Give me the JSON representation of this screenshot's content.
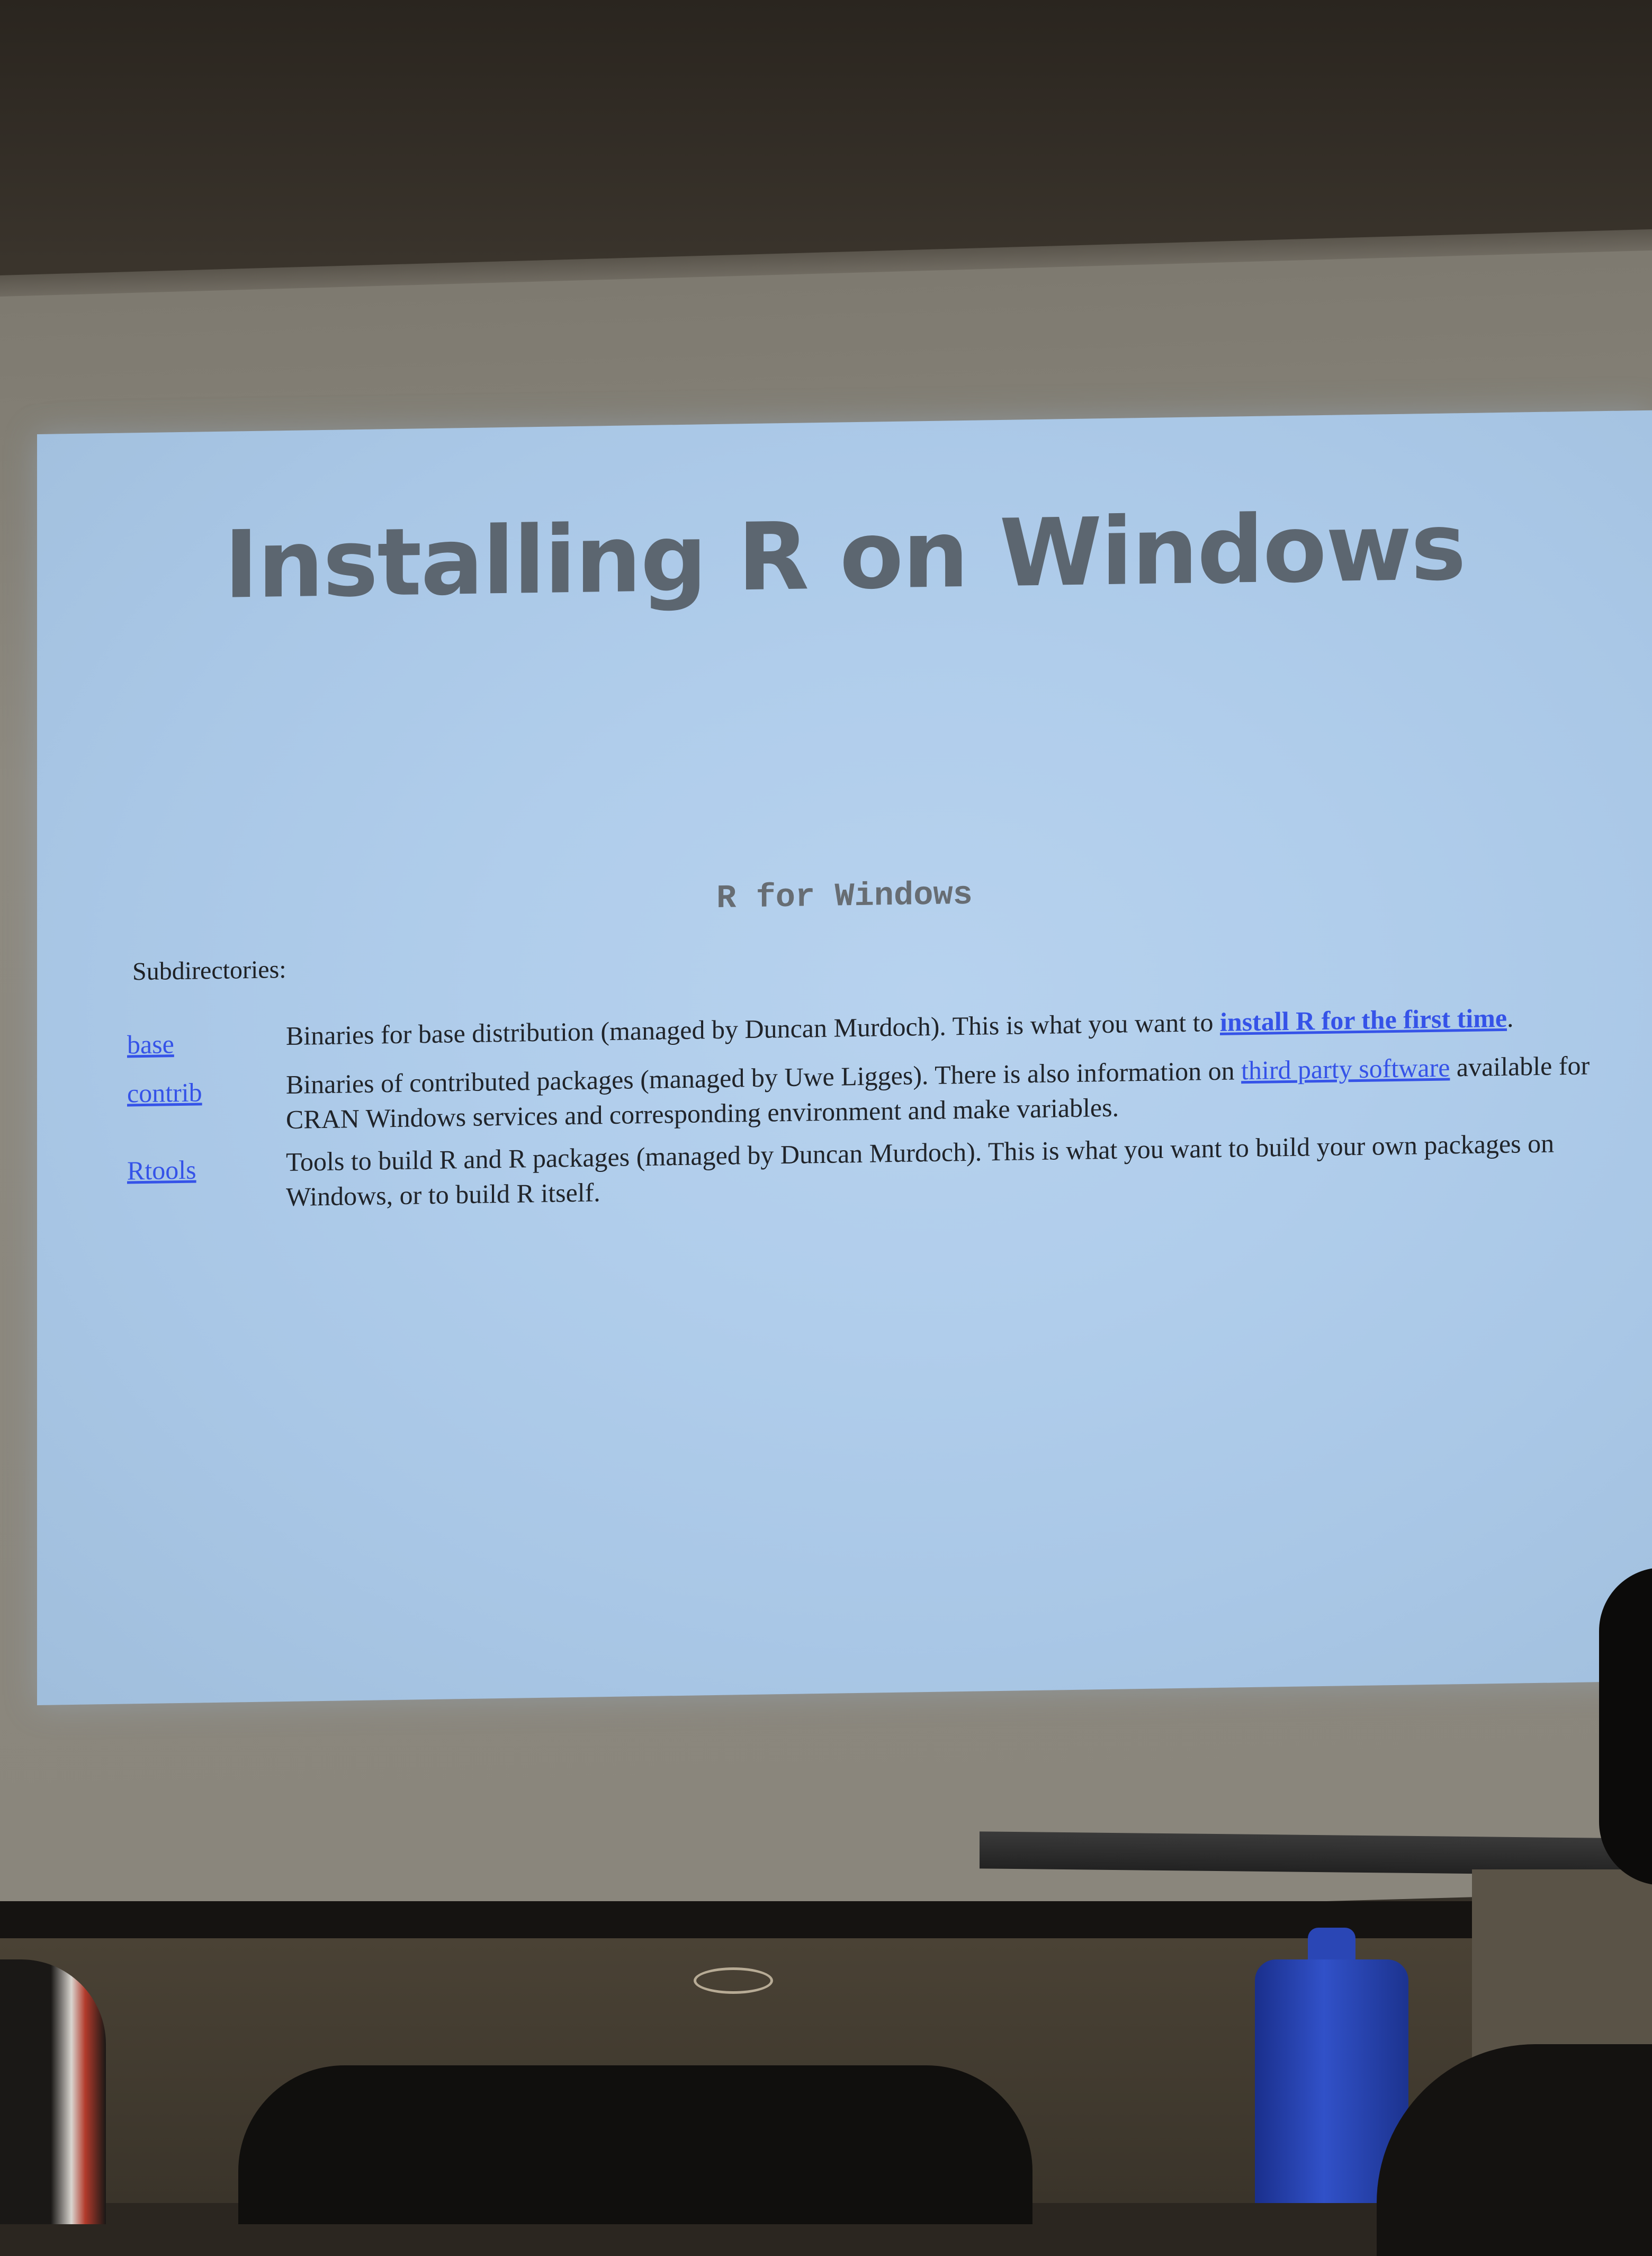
{
  "slide": {
    "title": "Installing R on Windows"
  },
  "webpage": {
    "heading": "R for Windows",
    "subdirectories_label": "Subdirectories:",
    "rows": [
      {
        "link": "base",
        "text_before": "Binaries for base distribution (managed by Duncan Murdoch). This is what you want to ",
        "inline_link": "install R for the first time",
        "text_after": "."
      },
      {
        "link": "contrib",
        "text_before": "Binaries of contributed packages (managed by Uwe Ligges). There is also information on ",
        "inline_link": "third party software",
        "text_after": " available for CRAN Windows services and corresponding environment and make variables."
      },
      {
        "link": "Rtools",
        "text_before": "Tools to build R and R packages (managed by Duncan Murdoch). This is what you want to build your own packages on Windows, or to build R itself.",
        "inline_link": "",
        "text_after": ""
      }
    ],
    "link_color": "#3553e8"
  },
  "scene": {
    "projection_color": "#b0cdeb",
    "bottle_color": "#3151c8"
  }
}
